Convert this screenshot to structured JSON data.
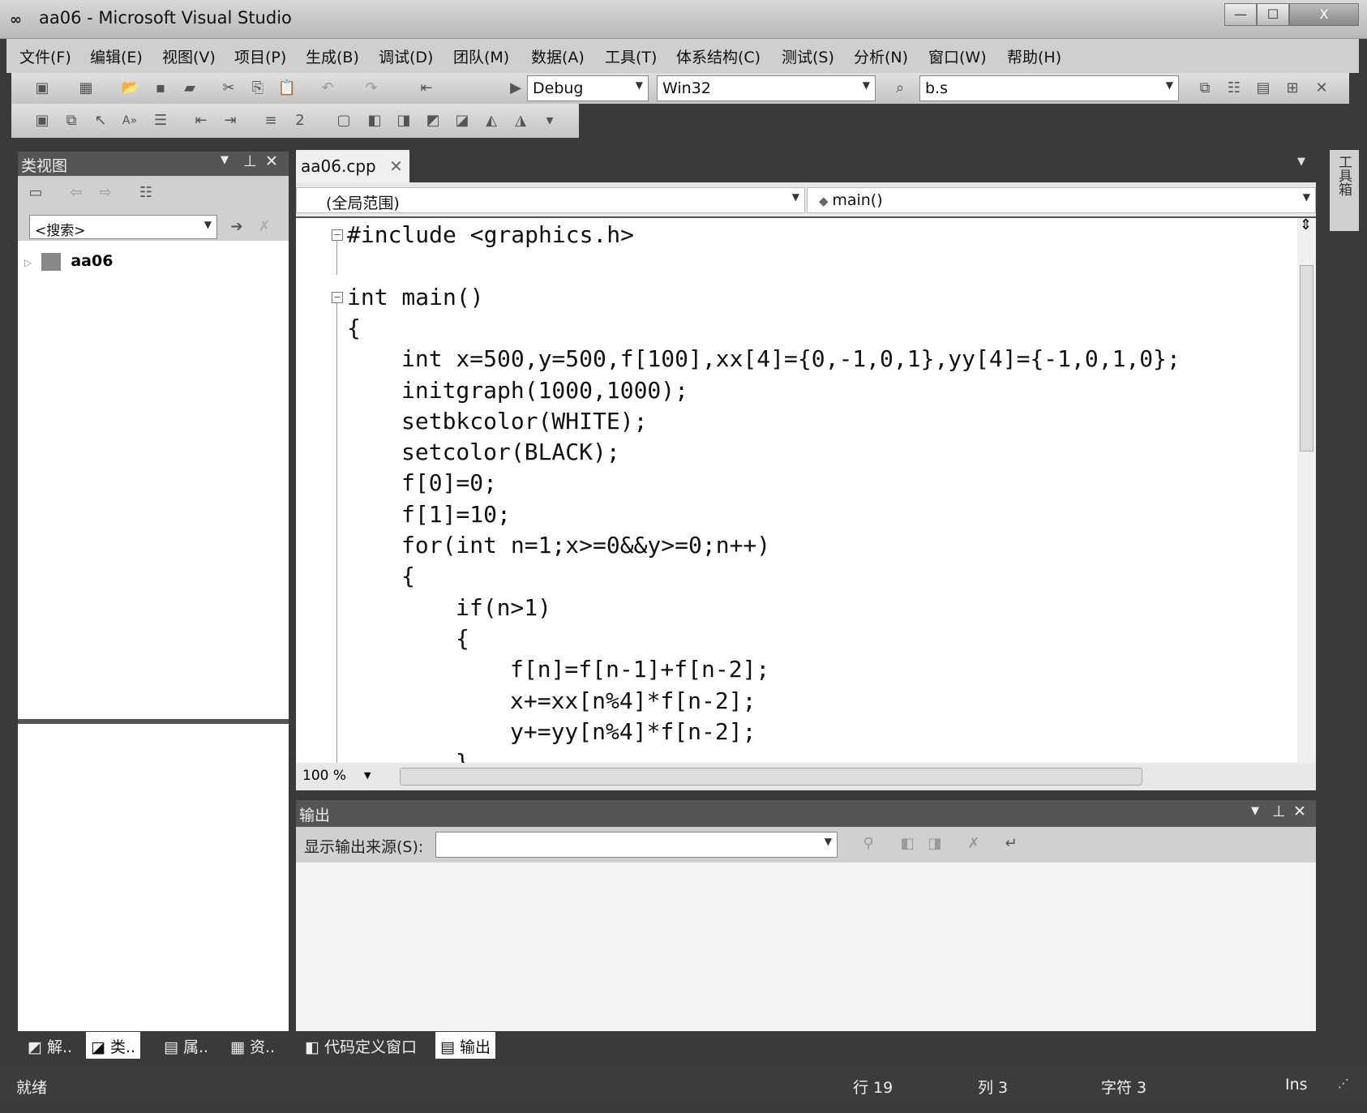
{
  "window": {
    "title": "aa06 - Microsoft Visual Studio",
    "minimize": "—",
    "maximize": "☐",
    "close": "X"
  },
  "menu": [
    "文件(F)",
    "编辑(E)",
    "视图(V)",
    "项目(P)",
    "生成(B)",
    "调试(D)",
    "团队(M)",
    "数据(A)",
    "工具(T)",
    "体系结构(C)",
    "测试(S)",
    "分析(N)",
    "窗口(W)",
    "帮助(H)"
  ],
  "toolbar": {
    "config": "Debug",
    "platform": "Win32",
    "find": "b.s"
  },
  "class_view": {
    "title": "类视图",
    "search_placeholder": "<搜索>",
    "tree_root": "aa06"
  },
  "editor": {
    "tab": "aa06.cpp",
    "scope": "(全局范围)",
    "member": "main()",
    "zoom": "100 %",
    "lines": [
      {
        "indent": 0,
        "text": "#include <graphics.h>",
        "fold": true
      },
      {
        "indent": 0,
        "text": ""
      },
      {
        "indent": 0,
        "text": "int main()",
        "fold": true
      },
      {
        "indent": 0,
        "text": "{"
      },
      {
        "indent": 1,
        "text": "int x=500,y=500,f[100],xx[4]={0,-1,0,1},yy[4]={-1,0,1,0};"
      },
      {
        "indent": 1,
        "text": "initgraph(1000,1000);"
      },
      {
        "indent": 1,
        "text": "setbkcolor(WHITE);"
      },
      {
        "indent": 1,
        "text": "setcolor(BLACK);"
      },
      {
        "indent": 1,
        "text": "f[0]=0;"
      },
      {
        "indent": 1,
        "text": "f[1]=10;"
      },
      {
        "indent": 1,
        "text": "for(int n=1;x>=0&&y>=0;n++)"
      },
      {
        "indent": 1,
        "text": "{"
      },
      {
        "indent": 2,
        "text": "if(n>1)"
      },
      {
        "indent": 2,
        "text": "{"
      },
      {
        "indent": 3,
        "text": "f[n]=f[n-1]+f[n-2];"
      },
      {
        "indent": 3,
        "text": "x+=xx[n%4]*f[n-2];"
      },
      {
        "indent": 3,
        "text": "y+=yy[n%4]*f[n-2];"
      },
      {
        "indent": 2,
        "text": "}"
      }
    ]
  },
  "output": {
    "title": "输出",
    "source_label": "显示输出来源(S):"
  },
  "bottom_tabs": [
    "解..",
    "类..",
    "属..",
    "资..",
    "代码定义窗口",
    "输出"
  ],
  "toolbox": "工具箱",
  "status": {
    "ready": "就绪",
    "line": "行 19",
    "col": "列 3",
    "char": "字符 3",
    "mode": "Ins"
  }
}
